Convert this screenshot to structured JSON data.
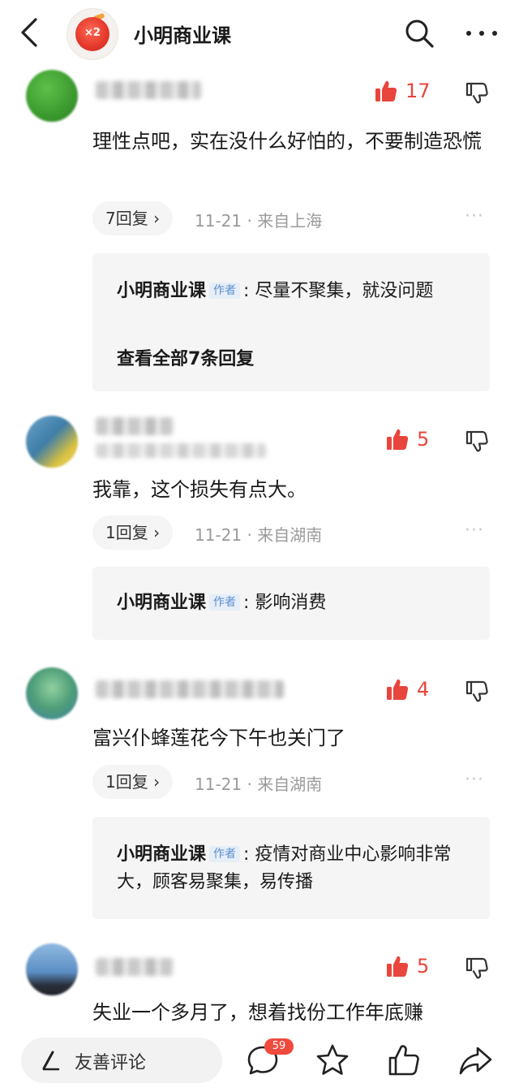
{
  "header": {
    "avatar_badge": "×2",
    "title": "小明商业课"
  },
  "comments": [
    {
      "likes": "17",
      "text": "理性点吧，实在没什么好怕的，不要制造恐慌",
      "reply_count_label": "7回复 ›",
      "date": "11-21",
      "location": "· 来自上海",
      "author_reply": {
        "author": "小明商业课",
        "badge": "作者",
        "text": "尽量不聚集，就没问题",
        "view_all": "查看全部7条回复"
      }
    },
    {
      "likes": "5",
      "text": "我靠，这个损失有点大。",
      "reply_count_label": "1回复 ›",
      "date": "11-21",
      "location": "· 来自湖南",
      "author_reply": {
        "author": "小明商业课",
        "badge": "作者",
        "text": "影响消费"
      }
    },
    {
      "likes": "4",
      "text": "富兴仆蜂莲花今下午也关门了",
      "reply_count_label": "1回复 ›",
      "date": "11-21",
      "location": "· 来自湖南",
      "author_reply": {
        "author": "小明商业课",
        "badge": "作者",
        "text": "疫情对商业中心影响非常大，顾客易聚集，易传播"
      }
    },
    {
      "likes": "5",
      "text": "失业一个多月了，想着找份工作年底赚"
    }
  ],
  "bottom_bar": {
    "placeholder": "友善评论",
    "comment_count": "59"
  },
  "colors": {
    "like_red": "#e8453c",
    "badge_blue": "#5b8fcf",
    "reply_box_bg": "#f5f5f5"
  }
}
